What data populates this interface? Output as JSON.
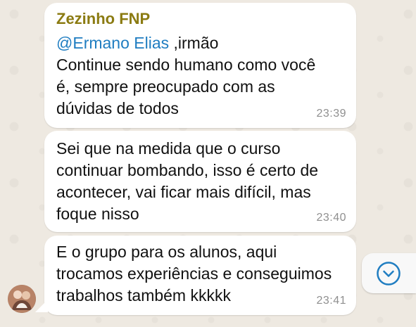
{
  "messages": [
    {
      "sender": "Zezinho FNP",
      "mention": "@Ermano Elias",
      "mention_suffix": " ,irmão",
      "lines": [
        "Continue sendo humano como você",
        "é, sempre preocupado com as",
        "dúvidas de todos"
      ],
      "time": "23:39"
    },
    {
      "lines": [
        "Sei que na medida que o curso",
        "continuar bombando, isso é certo de",
        "acontecer, vai ficar mais difícil, mas",
        "foque nisso"
      ],
      "time": "23:40"
    },
    {
      "lines": [
        "E o grupo para os alunos, aqui",
        "trocamos experiências e conseguimos",
        "trabalhos também kkkkk"
      ],
      "time": "23:41"
    }
  ],
  "icons": {
    "scroll": "chevron-down-icon",
    "avatar": "avatar"
  },
  "colors": {
    "sender": "#8b7b12",
    "mention": "#1f7dc1",
    "timestamp": "#8f8f8f",
    "accent": "#1f7dc1",
    "background": "#eee9e1"
  }
}
